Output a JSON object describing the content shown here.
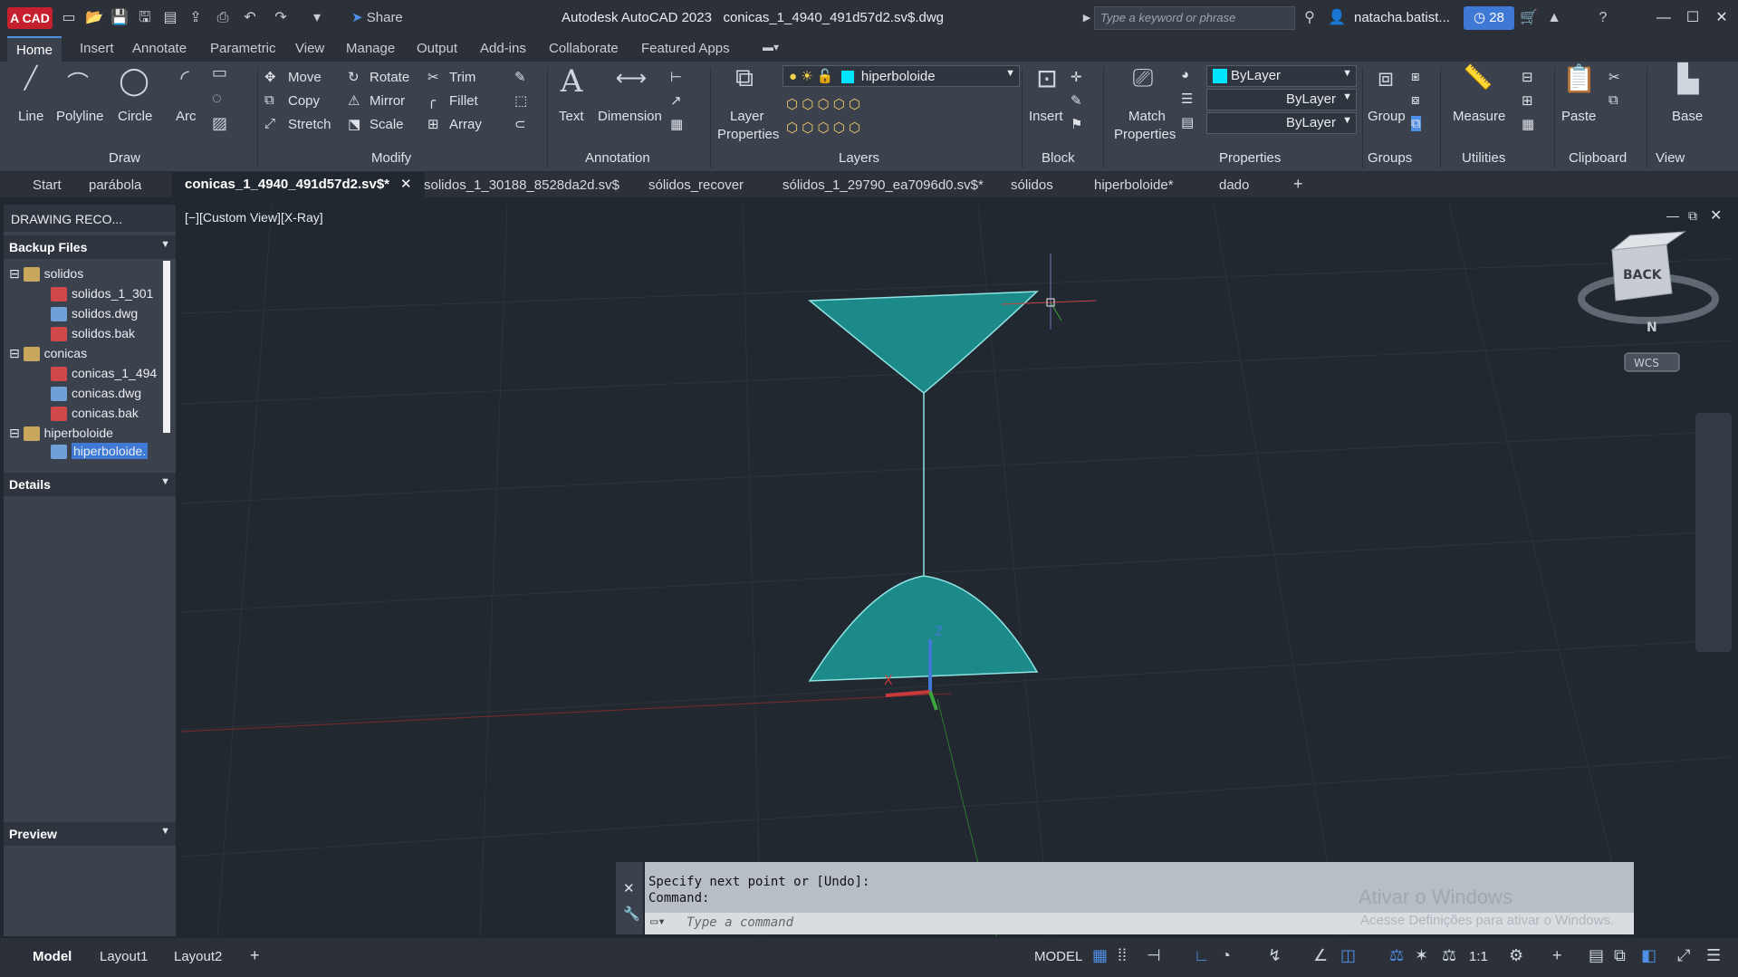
{
  "app": {
    "logo_label": "A CAD",
    "title": "Autodesk AutoCAD 2023",
    "filename": "conicas_1_4940_491d57d2.sv$.dwg",
    "share_label": "Share",
    "search_placeholder": "Type a keyword or phrase",
    "user": "natacha.batist...",
    "clock_count": "28"
  },
  "menu": {
    "tabs": [
      "Home",
      "Insert",
      "Annotate",
      "Parametric",
      "View",
      "Manage",
      "Output",
      "Add-ins",
      "Collaborate",
      "Featured Apps"
    ]
  },
  "ribbon": {
    "draw": {
      "line": "Line",
      "polyline": "Polyline",
      "circle": "Circle",
      "arc": "Arc",
      "group": "Draw"
    },
    "modify": {
      "move": "Move",
      "rotate": "Rotate",
      "trim": "Trim",
      "copy": "Copy",
      "mirror": "Mirror",
      "fillet": "Fillet",
      "stretch": "Stretch",
      "scale": "Scale",
      "array": "Array",
      "group": "Modify"
    },
    "annotation": {
      "text": "Text",
      "dimension": "Dimension",
      "group": "Annotation"
    },
    "layers": {
      "layer_properties_1": "Layer",
      "layer_properties_2": "Properties",
      "current_layer": "hiperboloide",
      "group": "Layers"
    },
    "block": {
      "insert": "Insert",
      "group": "Block"
    },
    "properties": {
      "match_1": "Match",
      "match_2": "Properties",
      "color": "ByLayer",
      "linetype": "ByLayer",
      "lineweight": "ByLayer",
      "group": "Properties"
    },
    "groups": {
      "group": "Group",
      "group_label": "Groups"
    },
    "utilities": {
      "measure": "Measure",
      "group": "Utilities"
    },
    "clipboard": {
      "paste": "Paste",
      "group": "Clipboard"
    },
    "view": {
      "base": "Base",
      "group": "View"
    }
  },
  "doc_tabs": [
    "Start",
    "parábola",
    "conicas_1_4940_491d57d2.sv$*",
    "solidos_1_30188_8528da2d.sv$",
    "sólidos_recover",
    "sólidos_1_29790_ea7096d0.sv$*",
    "sólidos",
    "hiperboloide*",
    "dado"
  ],
  "left_panel": {
    "title": "DRAWING RECO...",
    "backup_header": "Backup Files",
    "tree": [
      {
        "label": "solidos",
        "type": "folder"
      },
      {
        "label": "solidos_1_301",
        "type": "svs"
      },
      {
        "label": "solidos.dwg",
        "type": "dwg"
      },
      {
        "label": "solidos.bak",
        "type": "bak"
      },
      {
        "label": "conicas",
        "type": "folder"
      },
      {
        "label": "conicas_1_494",
        "type": "svs"
      },
      {
        "label": "conicas.dwg",
        "type": "dwg"
      },
      {
        "label": "conicas.bak",
        "type": "bak"
      },
      {
        "label": "hiperboloide",
        "type": "folder"
      },
      {
        "label": "hiperboloide.",
        "type": "dwg"
      }
    ],
    "details_header": "Details",
    "preview_header": "Preview"
  },
  "viewport": {
    "label": "[−][Custom View][X-Ray]",
    "viewcube_face": "BACK",
    "compass_n": "N",
    "wcs": "WCS"
  },
  "command": {
    "line1": "Specify next point or [Undo]:",
    "line2": "Command:",
    "placeholder": "Type a command"
  },
  "watermark": {
    "line1": "Ativar o Windows",
    "line2": "Acesse Definições para ativar o Windows."
  },
  "status": {
    "tabs": [
      "Model",
      "Layout1",
      "Layout2"
    ],
    "model_label": "MODEL",
    "scale": "1:1"
  },
  "colors": {
    "accent": "#3f79d6",
    "hyperboloid": "#1d8a8a",
    "edge": "#8fe3e3",
    "bg": "#212830"
  }
}
